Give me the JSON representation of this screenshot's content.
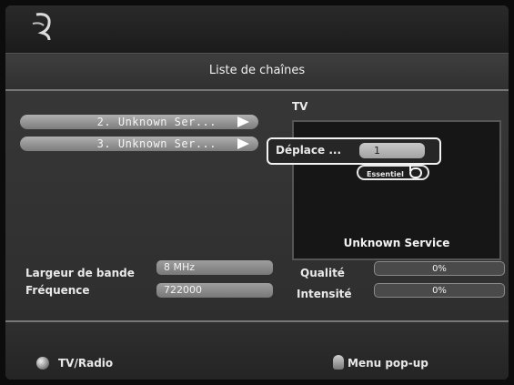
{
  "header": {
    "title": "Liste de chaînes"
  },
  "preview": {
    "label": "TV",
    "service_name": "Unknown Service"
  },
  "channels": [
    {
      "label": "2. Unknown Ser..."
    },
    {
      "label": "3. Unknown Ser..."
    }
  ],
  "move_popup": {
    "label": "Déplace ...",
    "value": "1"
  },
  "essentiel": {
    "label": "Essentiel"
  },
  "info": {
    "bandwidth_label": "Largeur de bande",
    "bandwidth_value": "8 MHz",
    "frequency_label": "Fréquence",
    "frequency_value": "722000",
    "quality_label": "Qualité",
    "quality_value": "0%",
    "intensity_label": "Intensité",
    "intensity_value": "0%"
  },
  "footer": {
    "tv_radio": "TV/Radio",
    "menu_popup": "Menu pop-up"
  },
  "icons": {
    "logo": "brand-logo-icon",
    "radio": "round-button-icon",
    "popup": "joystick-icon"
  }
}
